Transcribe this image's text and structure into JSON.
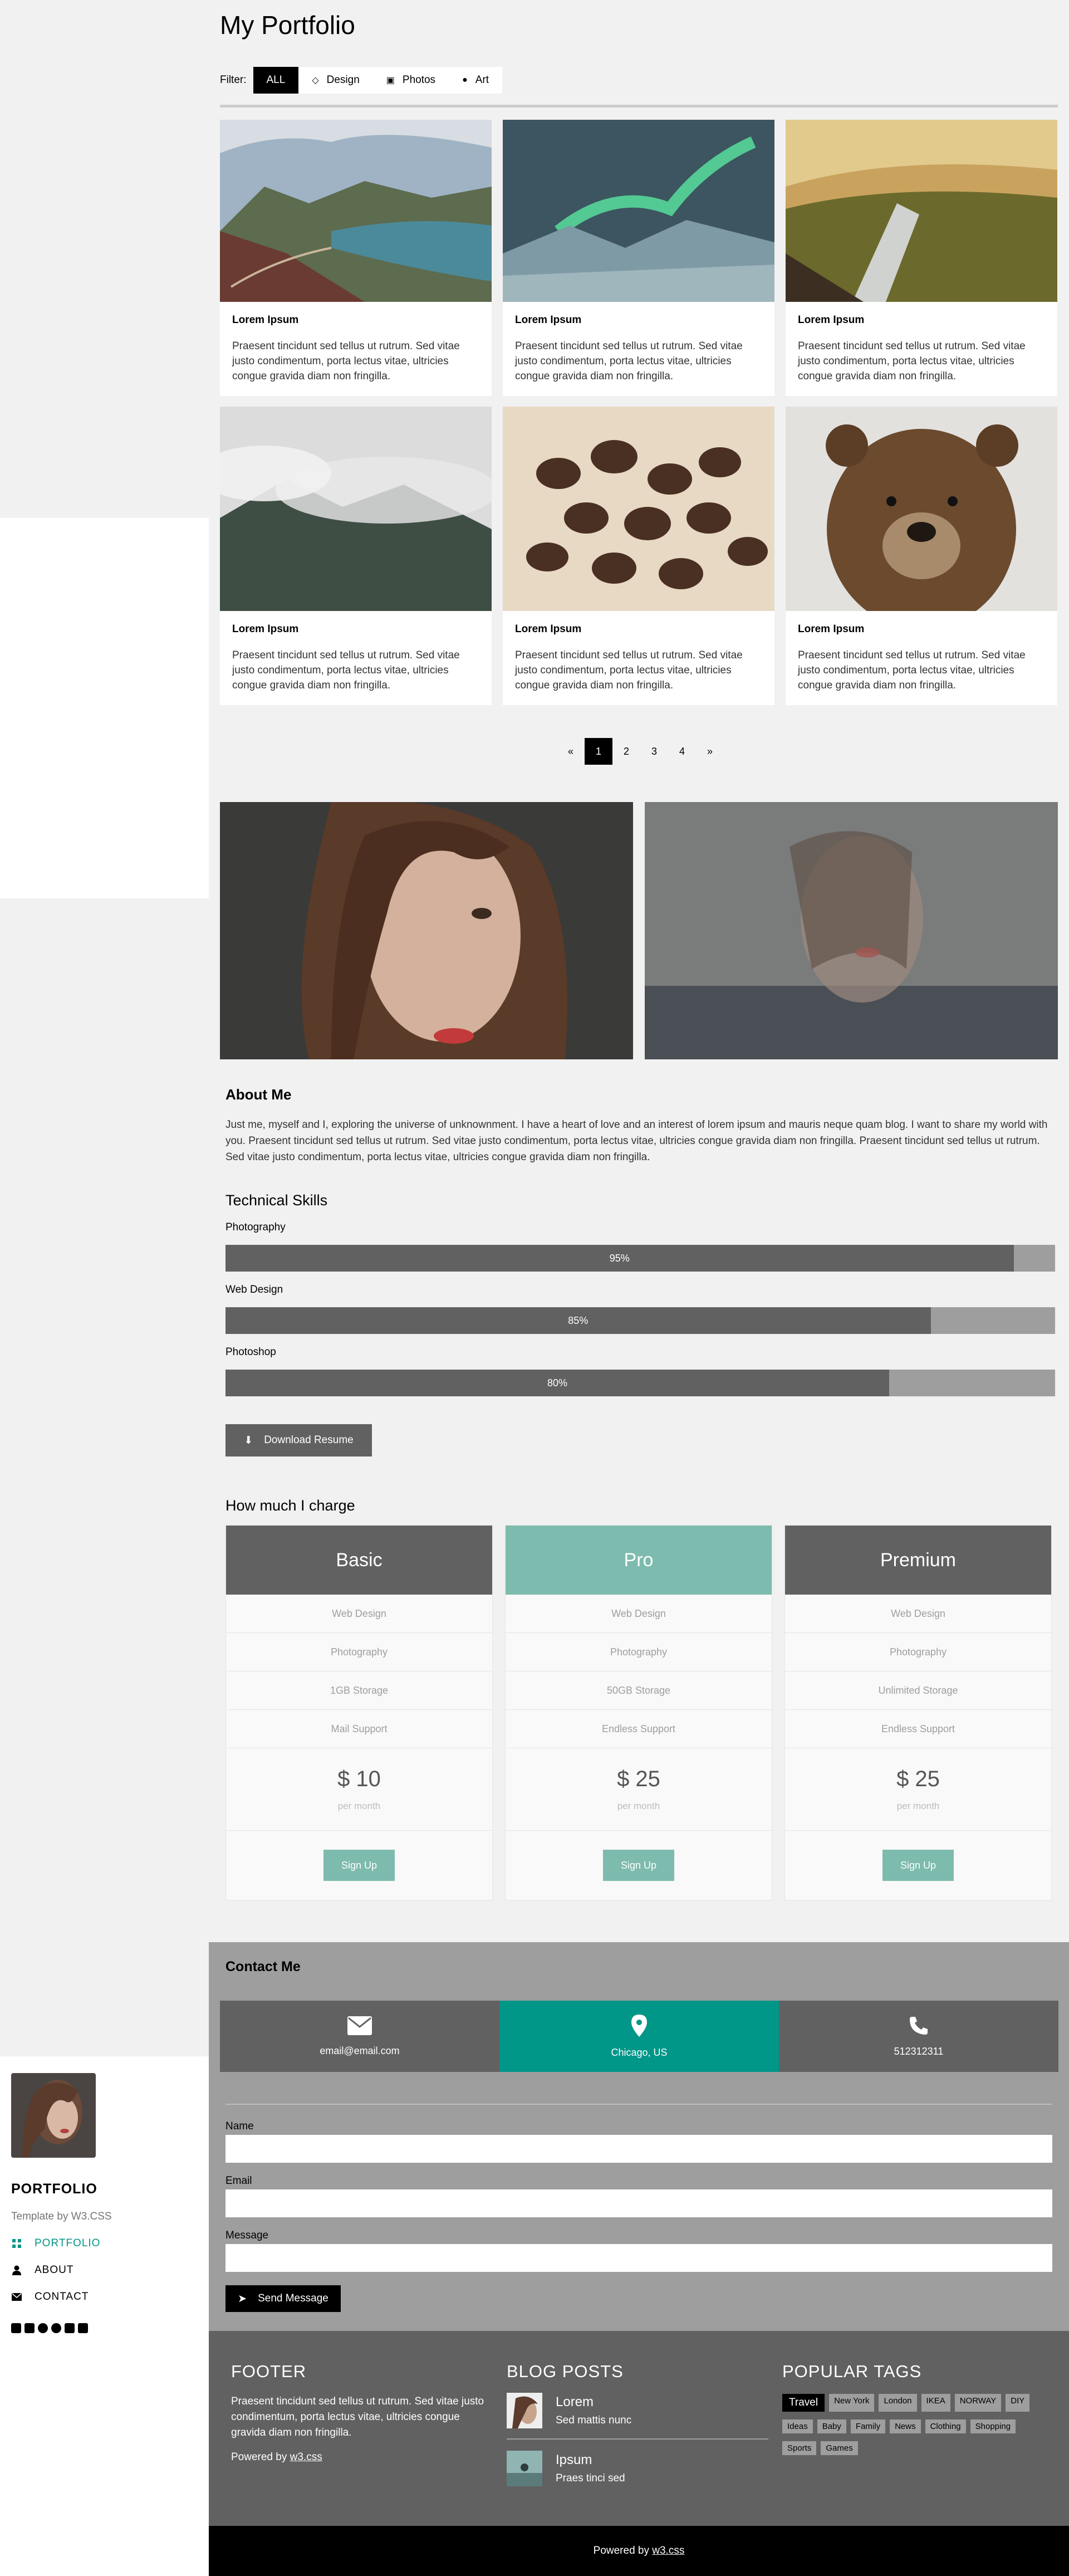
{
  "sidebar": {
    "title": "PORTFOLIO",
    "byline": "Template by W3.CSS",
    "nav": [
      {
        "label": "PORTFOLIO",
        "icon": "grid-icon"
      },
      {
        "label": "ABOUT",
        "icon": "user-icon"
      },
      {
        "label": "CONTACT",
        "icon": "envelope-icon"
      }
    ],
    "social": [
      "facebook-icon",
      "instagram-icon",
      "snapchat-icon",
      "pinterest-icon",
      "twitter-icon",
      "linkedin-icon"
    ]
  },
  "header": {
    "title": "My Portfolio"
  },
  "filter": {
    "label": "Filter:",
    "buttons": [
      {
        "label": "ALL",
        "icon": ""
      },
      {
        "label": "Design",
        "icon": "diamond-icon"
      },
      {
        "label": "Photos",
        "icon": "photo-icon"
      },
      {
        "label": "Art",
        "icon": "map-marker-icon"
      }
    ]
  },
  "cards": [
    {
      "title": "Lorem Ipsum",
      "text": "Praesent tincidunt sed tellus ut rutrum. Sed vitae justo condimentum, porta lectus vitae, ultricies congue gravida diam non fringilla."
    },
    {
      "title": "Lorem Ipsum",
      "text": "Praesent tincidunt sed tellus ut rutrum. Sed vitae justo condimentum, porta lectus vitae, ultricies congue gravida diam non fringilla."
    },
    {
      "title": "Lorem Ipsum",
      "text": "Praesent tincidunt sed tellus ut rutrum. Sed vitae justo condimentum, porta lectus vitae, ultricies congue gravida diam non fringilla."
    },
    {
      "title": "Lorem Ipsum",
      "text": "Praesent tincidunt sed tellus ut rutrum. Sed vitae justo condimentum, porta lectus vitae, ultricies congue gravida diam non fringilla."
    },
    {
      "title": "Lorem Ipsum",
      "text": "Praesent tincidunt sed tellus ut rutrum. Sed vitae justo condimentum, porta lectus vitae, ultricies congue gravida diam non fringilla."
    },
    {
      "title": "Lorem Ipsum",
      "text": "Praesent tincidunt sed tellus ut rutrum. Sed vitae justo condimentum, porta lectus vitae, ultricies congue gravida diam non fringilla."
    }
  ],
  "pagination": [
    "«",
    "1",
    "2",
    "3",
    "4",
    "»"
  ],
  "about": {
    "title": "About Me",
    "text": "Just me, myself and I, exploring the universe of unknownment. I have a heart of love and an interest of lorem ipsum and mauris neque quam blog. I want to share my world with you. Praesent tincidunt sed tellus ut rutrum. Sed vitae justo condimentum, porta lectus vitae, ultricies congue gravida diam non fringilla. Praesent tincidunt sed tellus ut rutrum. Sed vitae justo condimentum, porta lectus vitae, ultricies congue gravida diam non fringilla."
  },
  "skills": {
    "title": "Technical Skills",
    "items": [
      {
        "label": "Photography",
        "value": "95%",
        "percent": 95
      },
      {
        "label": "Web Design",
        "value": "85%",
        "percent": 85
      },
      {
        "label": "Photoshop",
        "value": "80%",
        "percent": 80
      }
    ],
    "download_label": "Download Resume"
  },
  "pricing": {
    "title": "How much I charge",
    "plans": [
      {
        "name": "Basic",
        "color": "#616161",
        "features": [
          "Web Design",
          "Photography",
          "1GB Storage",
          "Mail Support"
        ],
        "price": "$ 10",
        "period": "per month",
        "cta": "Sign Up"
      },
      {
        "name": "Pro",
        "color": "#7cbbad",
        "features": [
          "Web Design",
          "Photography",
          "50GB Storage",
          "Endless Support"
        ],
        "price": "$ 25",
        "period": "per month",
        "cta": "Sign Up"
      },
      {
        "name": "Premium",
        "color": "#616161",
        "features": [
          "Web Design",
          "Photography",
          "Unlimited Storage",
          "Endless Support"
        ],
        "price": "$ 25",
        "period": "per month",
        "cta": "Sign Up"
      }
    ]
  },
  "contact": {
    "title": "Contact Me",
    "boxes": [
      {
        "text": "email@email.com",
        "icon": "envelope-icon",
        "color": "#616161"
      },
      {
        "text": "Chicago, US",
        "icon": "map-marker-icon",
        "color": "#009688"
      },
      {
        "text": "512312311",
        "icon": "phone-icon",
        "color": "#616161"
      }
    ],
    "fields": {
      "name": "Name",
      "email": "Email",
      "message": "Message"
    },
    "send_label": "Send Message"
  },
  "footer": {
    "col1_title": "FOOTER",
    "col1_text": "Praesent tincidunt sed tellus ut rutrum. Sed vitae justo condimentum, porta lectus vitae, ultricies congue gravida diam non fringilla.",
    "powered_prefix": "Powered by",
    "powered_link": "w3.css",
    "col2_title": "BLOG POSTS",
    "posts": [
      {
        "title": "Lorem",
        "subtitle": "Sed mattis nunc"
      },
      {
        "title": "Ipsum",
        "subtitle": "Praes tinci sed"
      }
    ],
    "col3_title": "POPULAR TAGS",
    "tags": [
      "Travel",
      "New York",
      "London",
      "IKEA",
      "NORWAY",
      "DIY",
      "Ideas",
      "Baby",
      "Family",
      "News",
      "Clothing",
      "Shopping",
      "Sports",
      "Games"
    ]
  },
  "bottom": {
    "prefix": "Powered by",
    "link": "w3.css"
  }
}
